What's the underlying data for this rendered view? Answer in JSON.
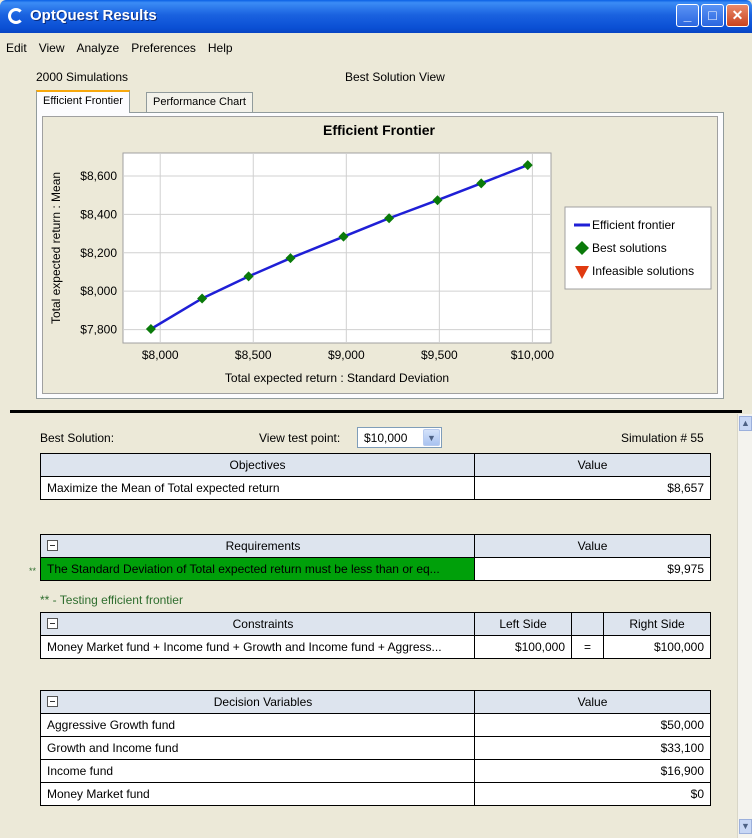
{
  "window": {
    "title": "OptQuest Results",
    "buttons": {
      "minimize": "_",
      "maximize": "□",
      "close": "✕"
    }
  },
  "menu": [
    "Edit",
    "View",
    "Analyze",
    "Preferences",
    "Help"
  ],
  "header": {
    "simulations": "2000 Simulations",
    "view_name": "Best Solution View"
  },
  "tabs": [
    {
      "label": "Efficient Frontier",
      "active": true
    },
    {
      "label": "Performance Chart",
      "active": false
    }
  ],
  "chart_data": {
    "type": "line",
    "title": "Efficient Frontier",
    "xlabel": "Total expected return : Standard Deviation",
    "ylabel": "Total expected return : Mean",
    "xlim": [
      7800,
      10100
    ],
    "ylim": [
      7730,
      8720
    ],
    "x_ticks": [
      8000,
      8500,
      9000,
      9500,
      10000
    ],
    "x_tick_labels": [
      "$8,000",
      "$8,500",
      "$9,000",
      "$9,500",
      "$10,000"
    ],
    "y_ticks": [
      7800,
      8000,
      8200,
      8400,
      8600
    ],
    "y_tick_labels": [
      "$7,800",
      "$8,000",
      "$8,200",
      "$8,400",
      "$8,600"
    ],
    "grid": true,
    "legend": "right",
    "series": [
      {
        "name": "Efficient frontier",
        "kind": "line",
        "color": "#1f1fd6",
        "x": [
          7950,
          8225,
          8475,
          8700,
          8985,
          9230,
          9490,
          9725,
          9975
        ],
        "y": [
          7803,
          7962,
          8077,
          8172,
          8284,
          8380,
          8474,
          8562,
          8657
        ]
      },
      {
        "name": "Best solutions",
        "kind": "marker",
        "color": "#0a7a0a",
        "x": [
          7950,
          8225,
          8475,
          8700,
          8985,
          9230,
          9490,
          9725,
          9975
        ],
        "y": [
          7803,
          7962,
          8077,
          8172,
          8284,
          8380,
          8474,
          8562,
          8657
        ]
      },
      {
        "name": "Infeasible solutions",
        "kind": "marker",
        "color": "#e03a10",
        "x": [],
        "y": []
      }
    ]
  },
  "best_solution": {
    "label": "Best Solution:",
    "view_test_point_label": "View test point:",
    "test_point_value": "$10,000",
    "simulation_label": "Simulation # 55"
  },
  "objectives": {
    "headers": [
      "Objectives",
      "Value"
    ],
    "rows": [
      [
        "Maximize the Mean of Total expected return",
        "$8,657"
      ]
    ]
  },
  "requirements": {
    "headers": [
      "Requirements",
      "Value"
    ],
    "marker": "**",
    "rows": [
      [
        "The Standard Deviation of Total expected return must be less than or eq...",
        "$9,975"
      ]
    ],
    "note": "** - Testing efficient frontier"
  },
  "constraints": {
    "headers": [
      "Constraints",
      "Left Side",
      "",
      "Right Side"
    ],
    "rows": [
      [
        "Money Market fund + Income fund + Growth and Income fund + Aggress...",
        "$100,000",
        "=",
        "$100,000"
      ]
    ]
  },
  "decision_variables": {
    "headers": [
      "Decision Variables",
      "Value"
    ],
    "rows": [
      [
        "Aggressive Growth fund",
        "$50,000"
      ],
      [
        "Growth and Income fund",
        "$33,100"
      ],
      [
        "Income fund",
        "$16,900"
      ],
      [
        "Money Market fund",
        "$0"
      ]
    ]
  }
}
